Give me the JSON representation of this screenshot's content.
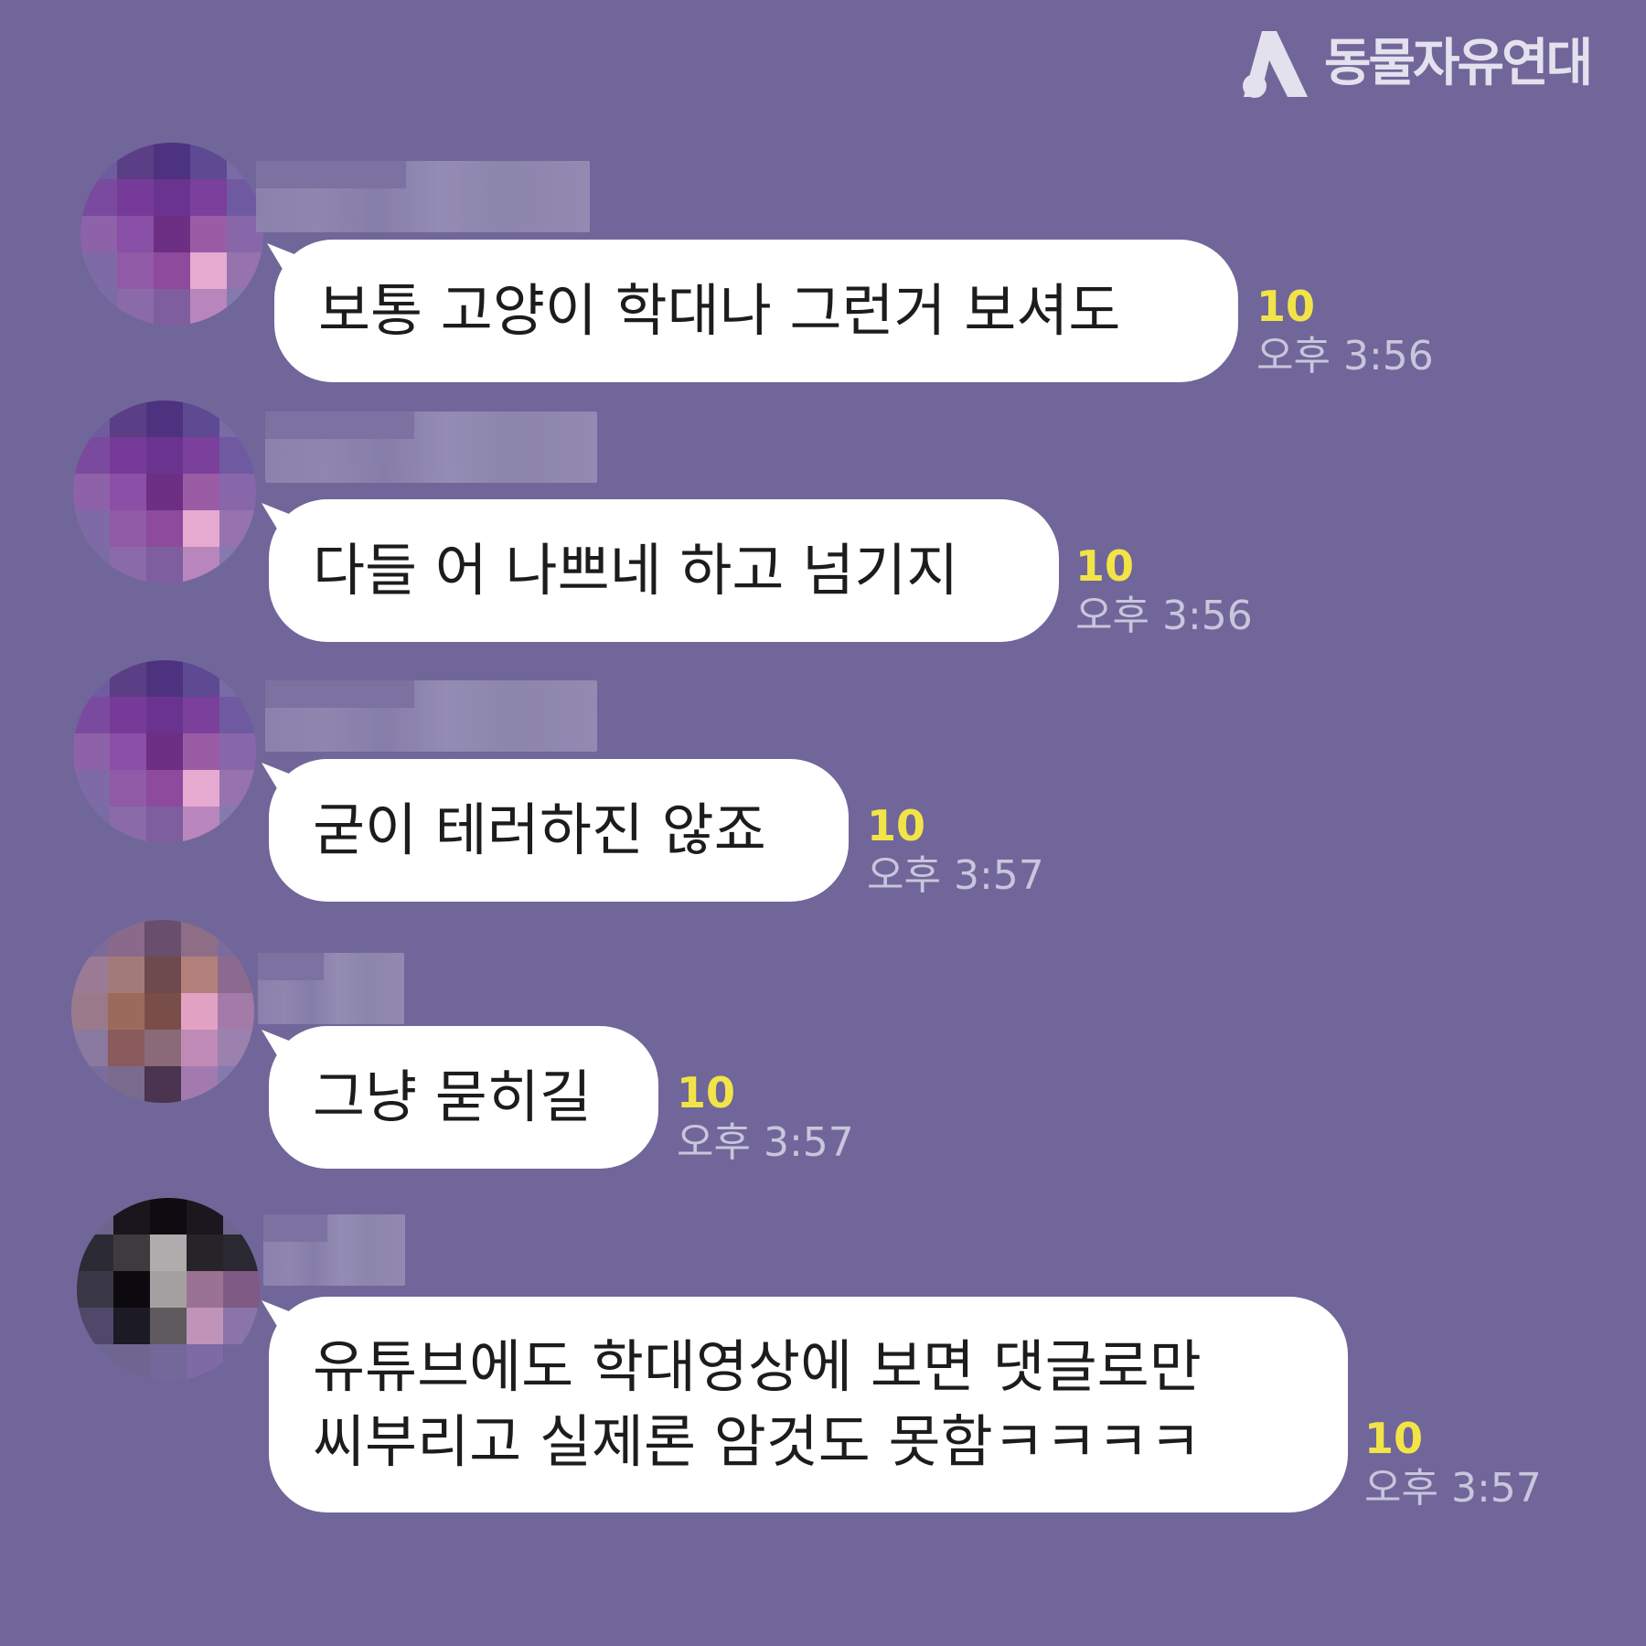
{
  "brand": {
    "name": "동물자유연대",
    "logo_icon": "org-logo-icon"
  },
  "chat": {
    "messages": [
      {
        "sender": "",
        "lines": [
          "보통 고양이 학대나 그런거 보셔도"
        ],
        "unread": "10",
        "time": "오후 3:56",
        "avatar": [
          "#6e5ba0",
          "#5a3f86",
          "#4d3280",
          "#5d4a92",
          "#7a6aa6",
          "#7a4a9e",
          "#763a98",
          "#6b3390",
          "#7b3f9c",
          "#6f5aa2",
          "#8e62a8",
          "#8a4fa6",
          "#6c2f84",
          "#9a5ca4",
          "#8866aa",
          "#7e6aa6",
          "#905aa6",
          "#8e4a9c",
          "#e6aad0",
          "#9672ae",
          "#7a6ca4",
          "#8a6aa8",
          "#7e5e9e",
          "#b886bc",
          "#857aae"
        ]
      },
      {
        "sender": "",
        "lines": [
          "다들 어 나쁘네 하고 넘기지"
        ],
        "unread": "10",
        "time": "오후 3:56",
        "avatar": [
          "#6e5ba0",
          "#5a3f86",
          "#4d3280",
          "#5d4a92",
          "#7a6aa6",
          "#7a4a9e",
          "#763a98",
          "#6b3390",
          "#7b3f9c",
          "#6f5aa2",
          "#8e62a8",
          "#8a4fa6",
          "#6c2f84",
          "#9a5ca4",
          "#8866aa",
          "#7e6aa6",
          "#905aa6",
          "#8e4a9c",
          "#e6aad0",
          "#9672ae",
          "#7a6ca4",
          "#8a6aa8",
          "#7e5e9e",
          "#b886bc",
          "#857aae"
        ]
      },
      {
        "sender": "",
        "lines": [
          "굳이 테러하진 않죠"
        ],
        "unread": "10",
        "time": "오후 3:57",
        "avatar": [
          "#6e5ba0",
          "#5a3f86",
          "#4d3280",
          "#5d4a92",
          "#7a6aa6",
          "#7a4a9e",
          "#763a98",
          "#6b3390",
          "#7b3f9c",
          "#6f5aa2",
          "#8e62a8",
          "#8a4fa6",
          "#6c2f84",
          "#9a5ca4",
          "#8866aa",
          "#7e6aa6",
          "#905aa6",
          "#8e4a9c",
          "#e6aad0",
          "#9672ae",
          "#7a6ca4",
          "#8a6aa8",
          "#7e5e9e",
          "#b886bc",
          "#857aae"
        ]
      },
      {
        "sender": "",
        "lines": [
          "그냥 묻히길"
        ],
        "unread": "10",
        "time": "오후 3:57",
        "avatar": [
          "#7c6a98",
          "#8a6a8a",
          "#6a4e6e",
          "#8e6e86",
          "#7c6c9e",
          "#9a7a94",
          "#a27a78",
          "#6e4a4e",
          "#b4807c",
          "#8c6a90",
          "#9a7a8a",
          "#9c6a5c",
          "#7a4e48",
          "#e2a2c4",
          "#a47aa8",
          "#8a7aa0",
          "#8a5a5c",
          "#8a6a78",
          "#c08ab6",
          "#9c80ae",
          "#7c6c9c",
          "#7a6a8e",
          "#4a3450",
          "#a27ab0",
          "#857aae"
        ]
      },
      {
        "sender": "",
        "lines": [
          "유튜브에도 학대영상에 보면 댓글로만",
          "씨부리고 실제론 암것도 못함ㅋㅋㅋㅋ"
        ],
        "unread": "10",
        "time": "오후 3:57",
        "avatar": [
          "#6e648e",
          "#18161c",
          "#0e0c10",
          "#1a181e",
          "#6e6690",
          "#2c2a34",
          "#3e3a3e",
          "#b0acae",
          "#262428",
          "#2a2830",
          "#3a3846",
          "#0c0a0e",
          "#a4a0a2",
          "#9a7294",
          "#7e5a84",
          "#50486a",
          "#1c1a24",
          "#5e5a5e",
          "#c094b8",
          "#8a74a8",
          "#6e6692",
          "#6e6690",
          "#74689a",
          "#7e6aa4",
          "#706699"
        ]
      }
    ]
  }
}
